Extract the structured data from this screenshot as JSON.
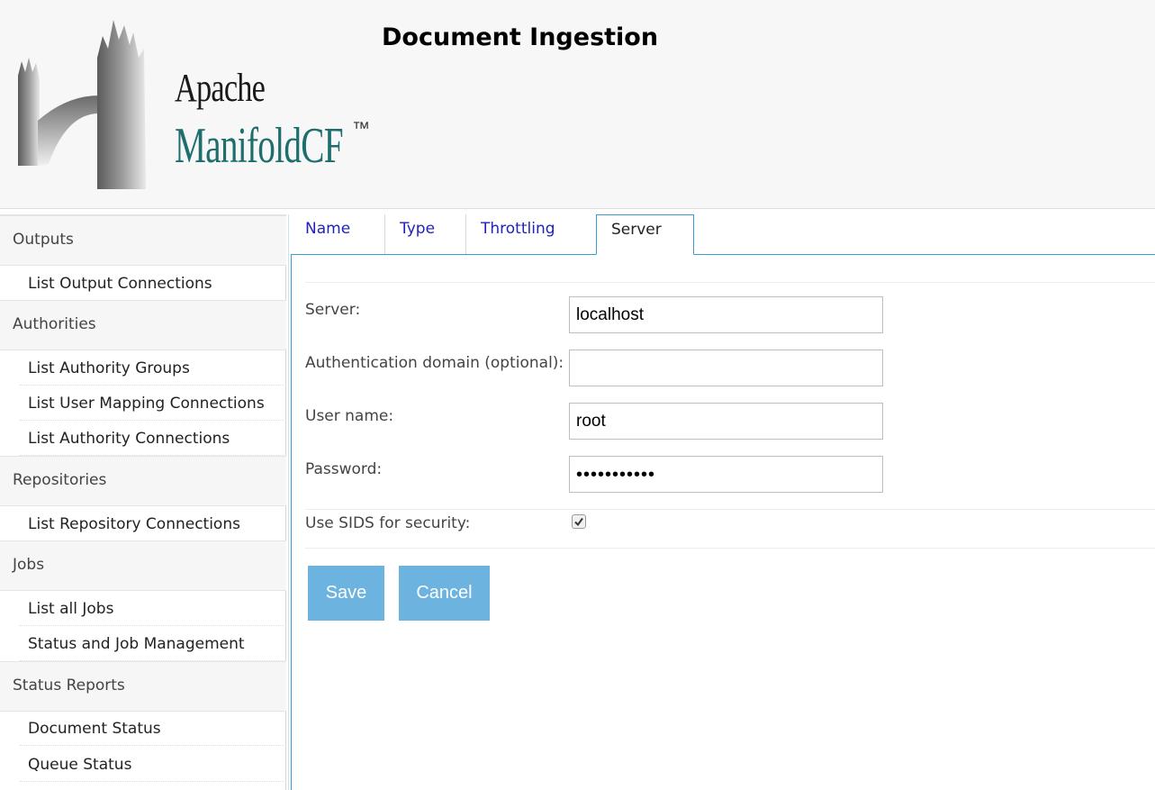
{
  "header": {
    "title": "Document Ingestion",
    "logo": {
      "line1": "Apache",
      "line2": "ManifoldCF",
      "trademark": "™"
    }
  },
  "sidebar": {
    "groups": [
      {
        "label": "Outputs",
        "items": [
          "List Output Connections"
        ]
      },
      {
        "label": "Authorities",
        "items": [
          "List Authority Groups",
          "List User Mapping Connections",
          "List Authority Connections"
        ]
      },
      {
        "label": "Repositories",
        "items": [
          "List Repository Connections"
        ]
      },
      {
        "label": "Jobs",
        "items": [
          "List all Jobs",
          "Status and Job Management"
        ]
      },
      {
        "label": "Status Reports",
        "items": [
          "Document Status",
          "Queue Status"
        ]
      }
    ]
  },
  "tabs": [
    {
      "label": "Name",
      "active": false
    },
    {
      "label": "Type",
      "active": false
    },
    {
      "label": "Throttling",
      "active": false
    },
    {
      "label": "Server",
      "active": true
    }
  ],
  "form": {
    "server": {
      "label": "Server:",
      "value": "localhost"
    },
    "domain": {
      "label": "Authentication domain (optional):",
      "value": ""
    },
    "username": {
      "label": "User name:",
      "value": "root"
    },
    "password": {
      "label": "Password:",
      "value": "•••••••••••"
    },
    "sids": {
      "label": "Use SIDS for security:",
      "checked": true
    }
  },
  "buttons": {
    "save": "Save",
    "cancel": "Cancel"
  },
  "colors": {
    "accent": "#3a9bd1",
    "button": "#6db3e0",
    "link": "#2222bb",
    "logo_teal": "#1f6e6e"
  }
}
